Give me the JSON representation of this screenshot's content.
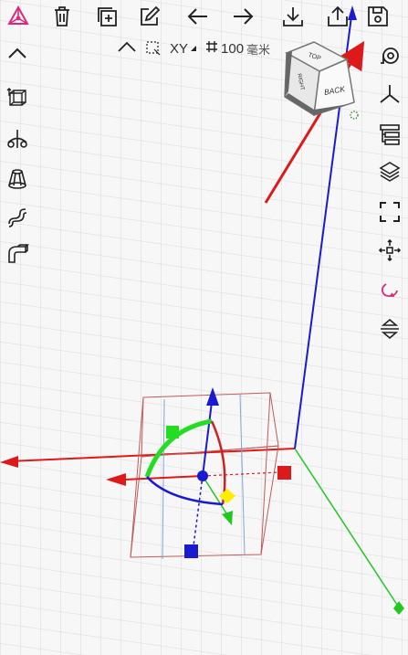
{
  "toolbar": {
    "items": [
      {
        "name": "app-logo-icon"
      },
      {
        "name": "delete-icon"
      },
      {
        "name": "duplicate-icon"
      },
      {
        "name": "edit-icon"
      },
      {
        "name": "undo-arrow-left-icon"
      },
      {
        "name": "redo-arrow-right-icon"
      },
      {
        "name": "import-icon"
      },
      {
        "name": "export-share-icon"
      },
      {
        "name": "save-icon"
      }
    ]
  },
  "status": {
    "plane": "XY",
    "grid_size": "100",
    "unit": "毫米"
  },
  "viewcube": {
    "top": "TOP",
    "back": "BACK",
    "right": "RIGHT"
  },
  "colors": {
    "x_axis": "#dd1a1a",
    "y_axis": "#22c722",
    "z_axis": "#1a1ad0",
    "gizmo_green": "#22dd22",
    "gizmo_red": "#cc2222",
    "gizmo_blue": "#1a1ad0",
    "gizmo_yellow": "#ffee00",
    "selection_box": "#c05a5a",
    "grid": "#d7d7d7",
    "logo": "#e0287a",
    "loop_icon": "#e0287a"
  }
}
